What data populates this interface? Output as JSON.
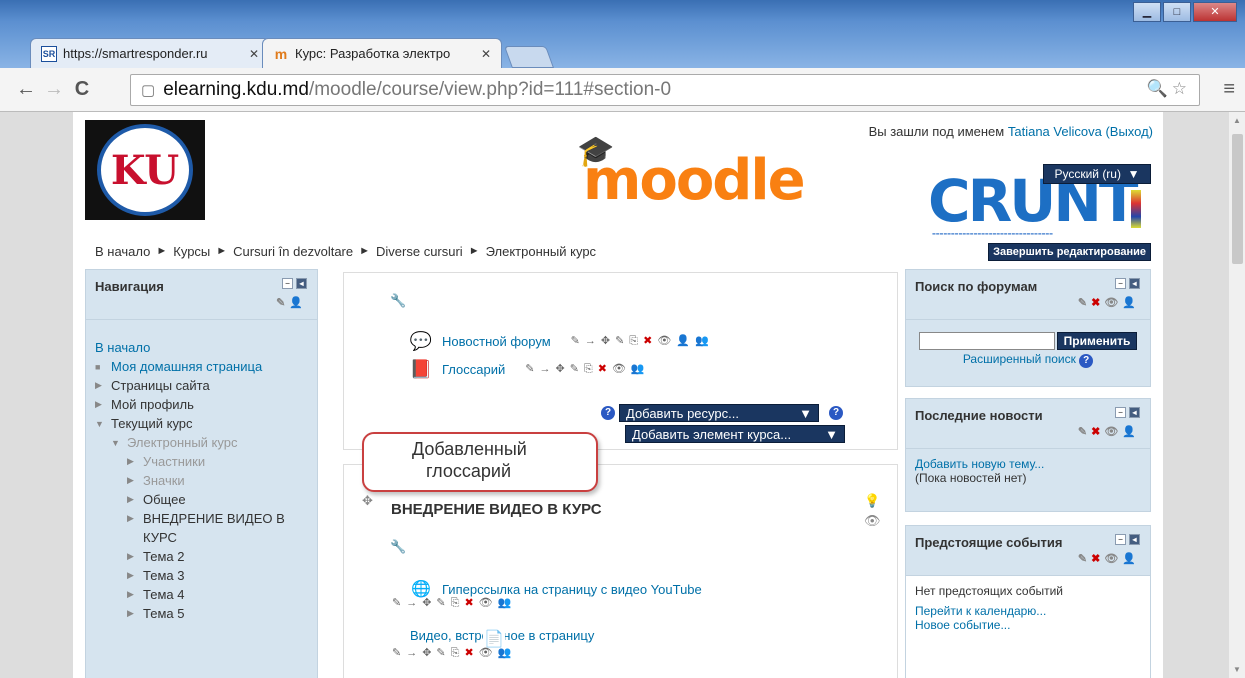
{
  "browser": {
    "tabs": [
      {
        "favicon": "SR",
        "title": "https://smartresponder.ru"
      },
      {
        "favicon": "m",
        "title": "Курс: Разработка электро"
      }
    ],
    "url_host": "elearning.kdu.md",
    "url_path": "/moodle/course/view.php?id=111#section-0"
  },
  "header": {
    "logged_in_prefix": "Вы зашли под именем",
    "user_name": "Tatiana Velicova",
    "logout": "(Выход)",
    "moodle_logo": "moodle",
    "crunt_logo": "CRUNT",
    "language": "Русский (ru)",
    "kdu_logo": "KU"
  },
  "breadcrumb": [
    "В начало",
    "Курсы",
    "Cursuri în dezvoltare",
    "Diverse cursuri",
    "Электронный курс"
  ],
  "edit_button": "Завершить редактирование",
  "nav": {
    "title": "Навигация",
    "items": [
      {
        "label": "В начало"
      },
      {
        "label": "Моя домашняя страница"
      },
      {
        "label": "Страницы сайта"
      },
      {
        "label": "Мой профиль"
      },
      {
        "label": "Текущий курс"
      },
      {
        "label": "Электронный курс"
      },
      {
        "label": "Участники"
      },
      {
        "label": "Значки"
      },
      {
        "label": "Общее"
      },
      {
        "label": "ВНЕДРЕНИЕ ВИДЕО В"
      },
      {
        "label": "КУРС"
      },
      {
        "label": "Тема 2"
      },
      {
        "label": "Тема 3"
      },
      {
        "label": "Тема 4"
      },
      {
        "label": "Тема 5"
      }
    ]
  },
  "section0": {
    "activities": [
      {
        "icon": "forum-icon",
        "label": "Новостной форум"
      },
      {
        "icon": "glossary-icon",
        "label": "Глоссарий"
      }
    ],
    "add_resource": "Добавить ресурс...",
    "add_activity": "Добавить элемент курса..."
  },
  "callout": {
    "line1": "Добавленный",
    "line2": "глоссарий"
  },
  "section1": {
    "title": "ВНЕДРЕНИЕ ВИДЕО В КУРС",
    "activities": [
      {
        "icon": "url-icon",
        "label": "Гиперссылка на страницу с видео YouTube"
      },
      {
        "icon": "page-icon",
        "label": "Видео, встроенное в страницу"
      }
    ]
  },
  "forum_search": {
    "title": "Поиск по форумам",
    "button": "Применить",
    "advanced": "Расширенный поиск"
  },
  "news": {
    "title": "Последние новости",
    "add_topic": "Добавить новую тему...",
    "none": "(Пока новостей нет)"
  },
  "events": {
    "title": "Предстоящие события",
    "none": "Нет предстоящих событий",
    "calendar": "Перейти к календарю...",
    "new_event": "Новое событие..."
  }
}
